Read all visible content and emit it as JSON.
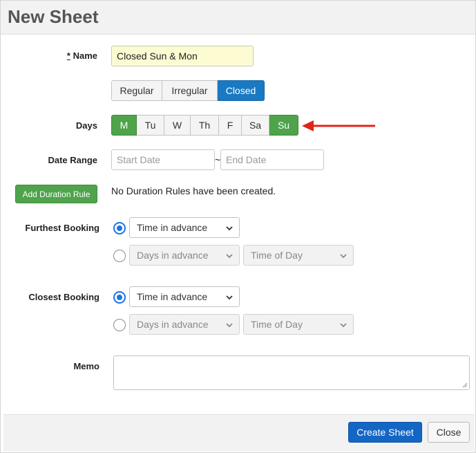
{
  "dialog": {
    "title": "New Sheet"
  },
  "name": {
    "required_mark": "*",
    "label": "Name",
    "value": "Closed Sun & Mon"
  },
  "schedule_type": {
    "options": [
      "Regular",
      "Irregular",
      "Closed"
    ],
    "selected": "Closed"
  },
  "days": {
    "label": "Days",
    "options": [
      "M",
      "Tu",
      "W",
      "Th",
      "F",
      "Sa",
      "Su"
    ],
    "selected": [
      "M",
      "Su"
    ]
  },
  "date_range": {
    "label": "Date Range",
    "start_placeholder": "Start Date",
    "separator": "~",
    "end_placeholder": "End Date"
  },
  "duration_rules": {
    "button_label": "Add Duration Rule",
    "empty_text": "No Duration Rules have been created."
  },
  "furthest_booking": {
    "label": "Furthest Booking",
    "option1": "Time in advance",
    "option2_days": "Days in advance",
    "option2_time": "Time of Day"
  },
  "closest_booking": {
    "label": "Closest Booking",
    "option1": "Time in advance",
    "option2_days": "Days in advance",
    "option2_time": "Time of Day"
  },
  "memo": {
    "label": "Memo"
  },
  "footer": {
    "create_label": "Create Sheet",
    "close_label": "Close"
  },
  "colors": {
    "accent_blue": "#1979c3",
    "active_green": "#4ea34b",
    "arrow_red": "#e0241b",
    "name_field_bg": "#fdfbd2"
  }
}
